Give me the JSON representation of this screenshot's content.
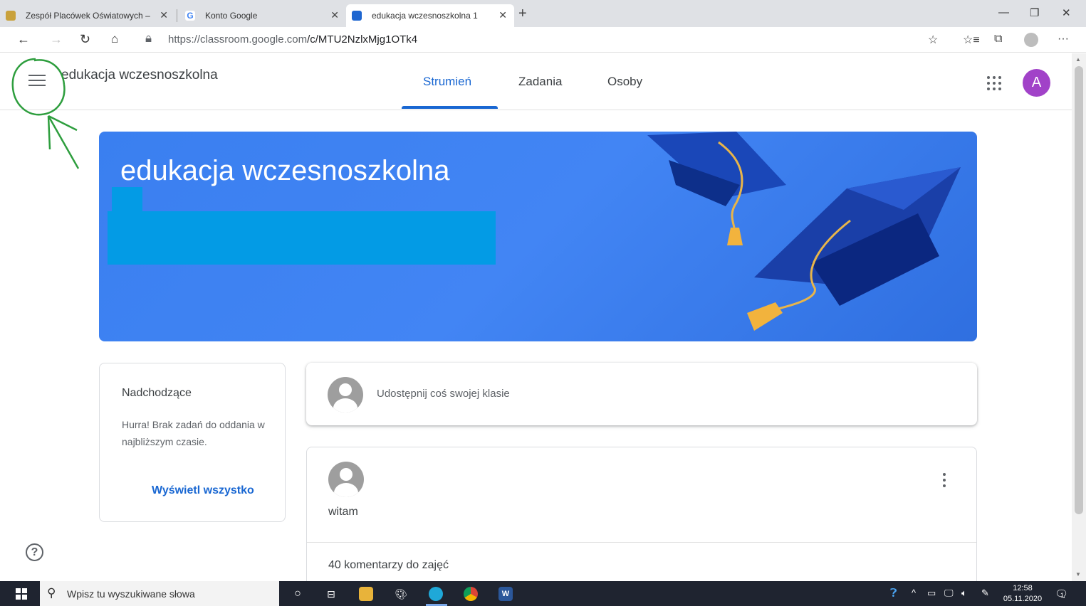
{
  "browser": {
    "tabs": [
      {
        "title": "Zespół Placówek Oświatowych –",
        "active": false
      },
      {
        "title": "Konto Google",
        "active": false
      },
      {
        "title": "edukacja wczesnoszkolna 1",
        "active": true
      }
    ],
    "url_host": "https://classroom.google.com",
    "url_path": "/c/MTU2NzlxMjg1OTk4"
  },
  "header": {
    "class_name": "edukacja wczesnoszkolna",
    "tabs": [
      "Strumień",
      "Zadania",
      "Osoby"
    ],
    "active_tab": "Strumień",
    "avatar_letter": "A",
    "avatar_color": "#a142c8"
  },
  "banner": {
    "title": "edukacja wczesnoszkolna",
    "color": "#4285f4"
  },
  "upcoming": {
    "title": "Nadchodzące",
    "text": "Hurra! Brak zadań do oddania w najbliższym czasie.",
    "link": "Wyświetl wszystko"
  },
  "share": {
    "placeholder": "Udostępnij coś swojej klasie"
  },
  "post": {
    "text": "witam",
    "comments": "40 komentarzy do zajęć"
  },
  "taskbar": {
    "search_placeholder": "Wpisz tu wyszukiwane słowa",
    "time": "12:58",
    "date": "05.11.2020",
    "notification_count": "1"
  },
  "annotation_color": "#2e9e3e",
  "accent_color": "#1967d2"
}
